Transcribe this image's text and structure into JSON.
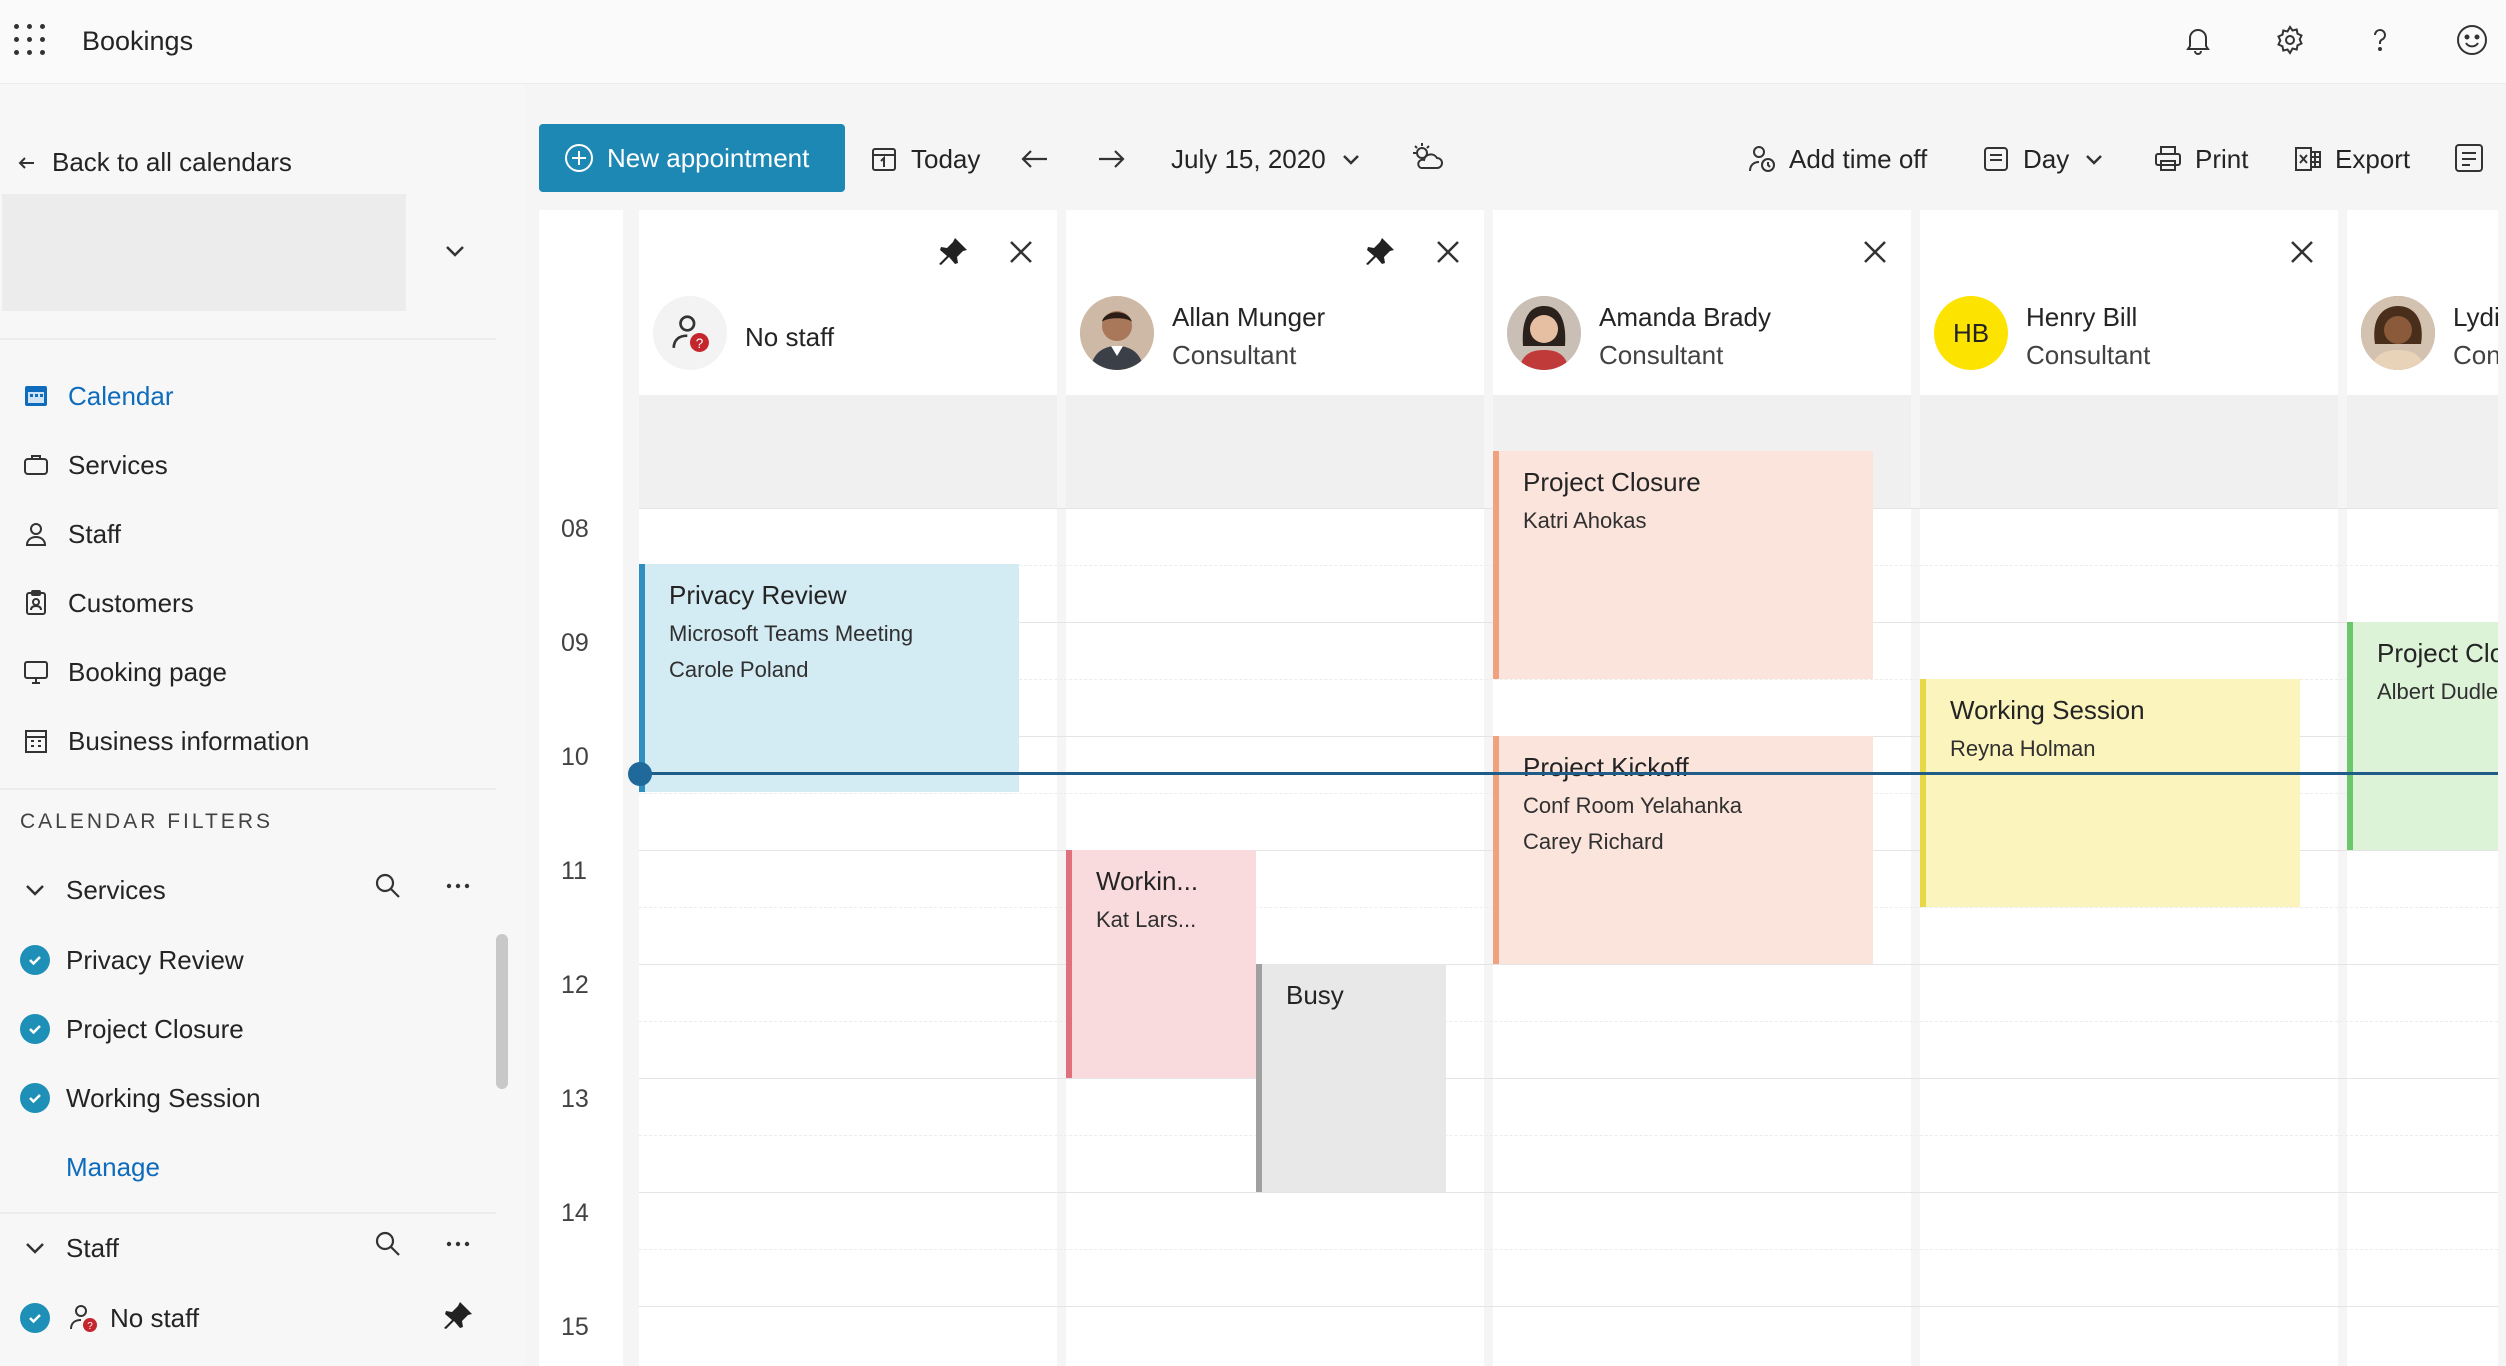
{
  "app": {
    "title": "Bookings",
    "icons": [
      "waffle-icon",
      "bell-icon",
      "gear-icon",
      "help-icon",
      "smiley-icon"
    ]
  },
  "sidebar": {
    "back_label": "Back to all calendars",
    "nav": [
      {
        "label": "Calendar",
        "icon": "calendar-icon",
        "active": true
      },
      {
        "label": "Services",
        "icon": "briefcase-icon"
      },
      {
        "label": "Staff",
        "icon": "person-icon"
      },
      {
        "label": "Customers",
        "icon": "clipboard-person-icon"
      },
      {
        "label": "Booking page",
        "icon": "monitor-icon"
      },
      {
        "label": "Business information",
        "icon": "building-icon"
      }
    ],
    "filters_label": "CALENDAR FILTERS",
    "services_group": {
      "label": "Services",
      "items": [
        "Privacy Review",
        "Project Closure",
        "Working Session"
      ],
      "manage_label": "Manage"
    },
    "staff_group": {
      "label": "Staff",
      "items": [
        "No staff"
      ]
    }
  },
  "toolbar": {
    "new_appointment": "New appointment",
    "today": "Today",
    "date": "July 15, 2020",
    "add_time_off": "Add time off",
    "view": "Day",
    "print": "Print",
    "export": "Export"
  },
  "calendar": {
    "hours": [
      "08",
      "09",
      "10",
      "11",
      "12",
      "13",
      "14",
      "15"
    ],
    "columns": [
      {
        "name": "No staff",
        "role": "",
        "avatar": "no-staff",
        "pinned": true
      },
      {
        "name": "Allan Munger",
        "role": "Consultant",
        "avatar": "photo",
        "pinned": true
      },
      {
        "name": "Amanda Brady",
        "role": "Consultant",
        "avatar": "photo",
        "pinned": false
      },
      {
        "name": "Henry Bill",
        "role": "Consultant",
        "avatar": "initials",
        "initials": "HB",
        "pinned": false
      },
      {
        "name": "Lydi",
        "role": "Con",
        "avatar": "photo",
        "pinned": false
      }
    ],
    "events": [
      {
        "title": "Privacy Review",
        "lines": [
          "Microsoft Teams Meeting",
          "Carole Poland"
        ],
        "color": "#d3ebf3",
        "accent": "#2f8fc0"
      },
      {
        "title": "Project Closure",
        "lines": [
          "Katri Ahokas"
        ],
        "color": "#fbe4dc",
        "accent": "#f0a27e"
      },
      {
        "title": "Project Kickoff",
        "lines": [
          "Conf Room Yelahanka",
          "Carey Richard"
        ],
        "color": "#fbe4dc",
        "accent": "#f0a27e"
      },
      {
        "title": "Workin...",
        "lines": [
          "Kat Lars..."
        ],
        "color": "#f9dadd",
        "accent": "#e0707c"
      },
      {
        "title": "Busy",
        "lines": [],
        "color": "#e8e8e8",
        "accent": "#a0a0a0"
      },
      {
        "title": "Working Session",
        "lines": [
          "Reyna Holman"
        ],
        "color": "#fbf4bd",
        "accent": "#e8d845"
      },
      {
        "title": "Project Clo",
        "lines": [
          "Albert Dudle"
        ],
        "color": "#dcf3d8",
        "accent": "#6cc66a"
      }
    ]
  },
  "colors": {
    "accent": "#1e88b5",
    "link": "#0f6cbd",
    "now_line": "#1f5c87"
  }
}
